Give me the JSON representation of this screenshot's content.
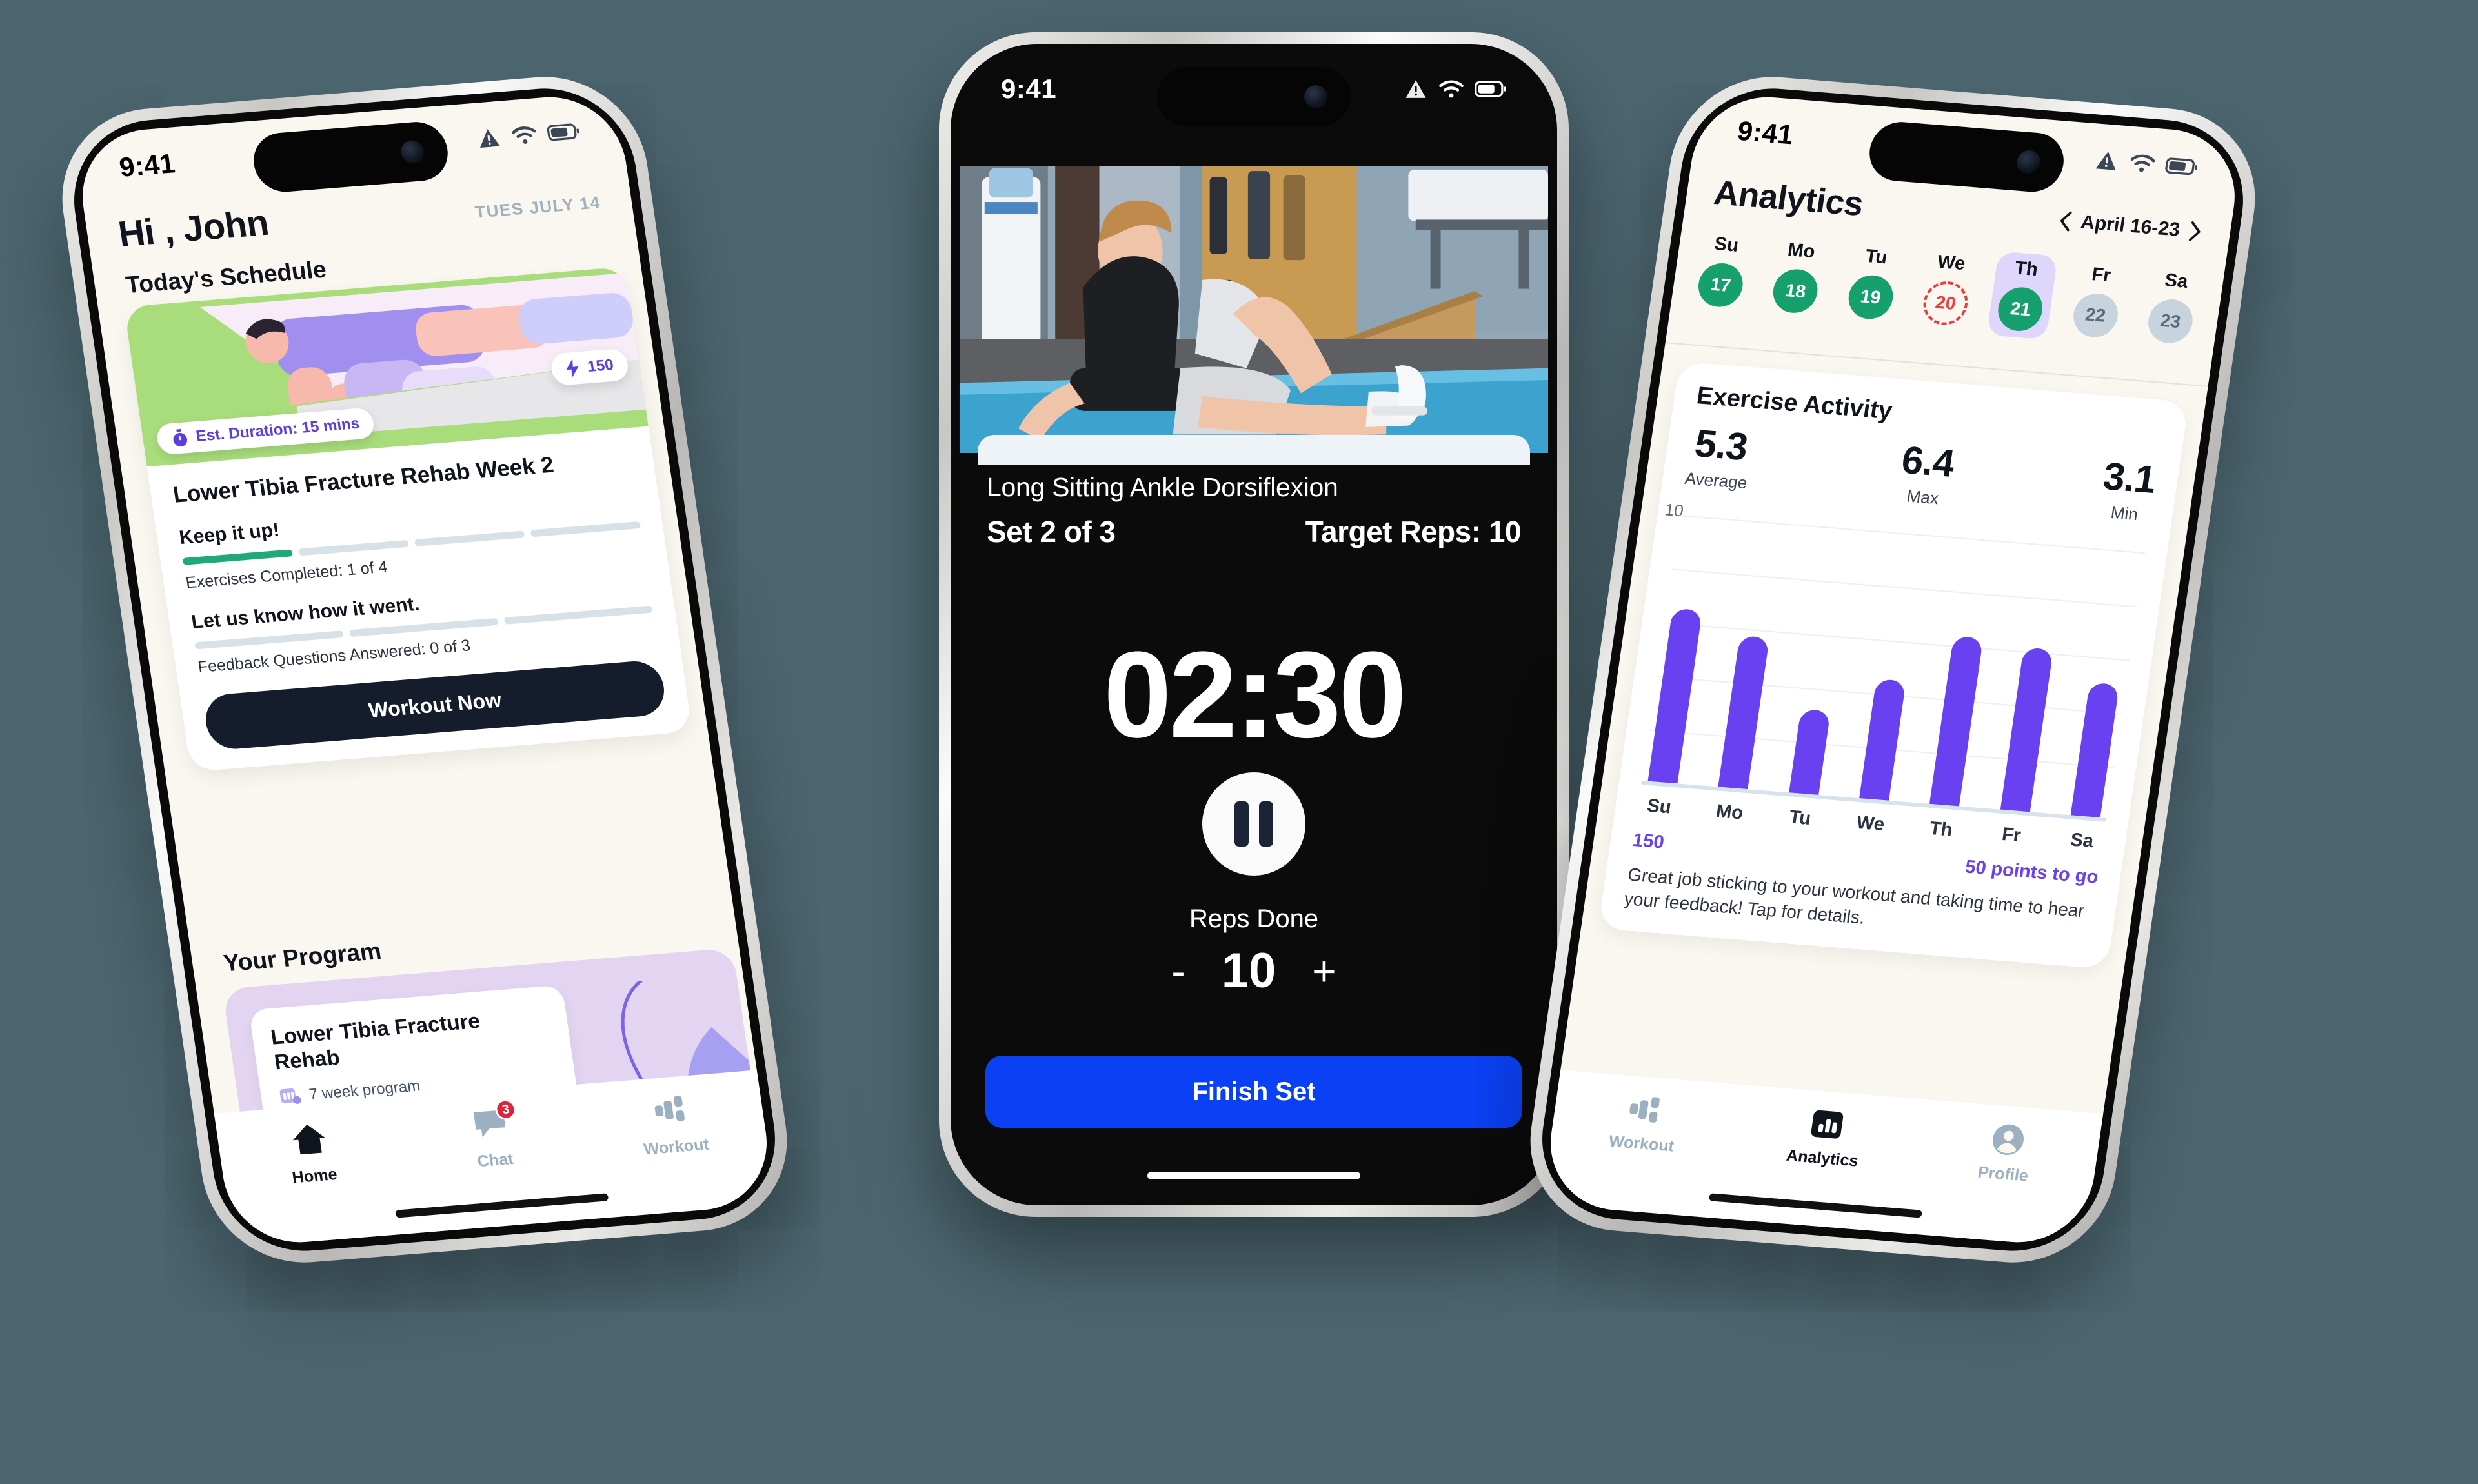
{
  "background_color": "#4c6670",
  "accent_colors": {
    "purple": "#6a41f0",
    "blue": "#0b41f5",
    "green": "#15a06e",
    "red": "#ef3b3b",
    "dark": "#151c2c"
  },
  "left_phone": {
    "status_bar": {
      "time": "9:41",
      "icons": [
        "alert-icon",
        "wifi-icon",
        "battery-icon"
      ]
    },
    "greeting": "Hi , John",
    "date": "TUES JULY 14",
    "section_today": "Today's Schedule",
    "hero": {
      "duration_badge": "Est. Duration: 15 mins",
      "duration_icon": "stopwatch-icon",
      "points_badge": "150",
      "points_icon": "bolt-icon"
    },
    "workout_title": "Lower Tibia Fracture Rehab Week 2",
    "keep_it_up": "Keep it up!",
    "exercises_progress": {
      "label": "Exercises Completed: 1 of 4",
      "segments": 4,
      "completed": 1
    },
    "feedback_heading": "Let us know how it went.",
    "feedback_progress": {
      "label": "Feedback Questions Answered: 0 of 3",
      "segments": 3,
      "completed": 0
    },
    "primary_button": "Workout Now",
    "section_program": "Your Program",
    "program_card": {
      "title": "Lower Tibia Fracture Rehab",
      "meta": "7 week program",
      "meta_icon": "calendar-icon"
    },
    "tabs": [
      {
        "label": "Home",
        "icon": "home-icon",
        "active": true,
        "badge": ""
      },
      {
        "label": "Chat",
        "icon": "chat-icon",
        "active": false,
        "badge": "3"
      },
      {
        "label": "Workout",
        "icon": "workout-icon",
        "active": false,
        "badge": ""
      }
    ]
  },
  "center_phone": {
    "status_bar": {
      "time": "9:41",
      "icons": [
        "alert-icon",
        "wifi-icon",
        "battery-icon"
      ]
    },
    "video": {
      "alt": "physical therapist seated on blue mat demonstrating long sitting ankle dorsiflexion"
    },
    "exercise_name": "Long Sitting Ankle Dorsiflexion",
    "set_label": "Set 2 of 3",
    "target_reps_label": "Target Reps: 10",
    "timer": "02:30",
    "pause_icon": "pause-icon",
    "reps_done_label": "Reps Done",
    "reps_minus": "-",
    "reps_value": "10",
    "reps_plus": "+",
    "finish_button": "Finish Set"
  },
  "right_phone": {
    "status_bar": {
      "time": "9:41",
      "icons": [
        "alert-icon",
        "wifi-icon",
        "battery-icon"
      ]
    },
    "title": "Analytics",
    "date_range": "April 16-23",
    "prev_icon": "chevron-left-icon",
    "next_icon": "chevron-right-icon",
    "calendar": [
      {
        "dow": "Su",
        "day": "17",
        "state": "done"
      },
      {
        "dow": "Mo",
        "day": "18",
        "state": "done"
      },
      {
        "dow": "Tu",
        "day": "19",
        "state": "done"
      },
      {
        "dow": "We",
        "day": "20",
        "state": "today"
      },
      {
        "dow": "Th",
        "day": "21",
        "state": "done",
        "selected": true
      },
      {
        "dow": "Fr",
        "day": "22",
        "state": "future"
      },
      {
        "dow": "Sa",
        "day": "23",
        "state": "future"
      }
    ],
    "card_title": "Exercise Activity",
    "stats": [
      {
        "value": "5.3",
        "label": "Average"
      },
      {
        "value": "6.4",
        "label": "Max"
      },
      {
        "value": "3.1",
        "label": "Min"
      }
    ],
    "points_left": "150",
    "points_to_go": "50 points to go",
    "note": "Great job sticking to your workout and taking time to hear your feedback! Tap for details.",
    "tabs": [
      {
        "label": "Workout",
        "icon": "workout-icon",
        "active": false
      },
      {
        "label": "Analytics",
        "icon": "analytics-icon",
        "active": true
      },
      {
        "label": "Profile",
        "icon": "profile-icon",
        "active": false
      }
    ]
  },
  "chart_data": {
    "type": "bar",
    "title": "Exercise Activity",
    "categories": [
      "Su",
      "Mo",
      "Tu",
      "We",
      "Th",
      "Fr",
      "Sa"
    ],
    "values": [
      6.4,
      5.6,
      3.1,
      4.4,
      6.2,
      6.0,
      4.9
    ],
    "xlabel": "",
    "ylabel": "",
    "ylim": [
      0,
      10
    ],
    "ytick_labels": [
      "10"
    ],
    "grid": true,
    "legend": "none",
    "bar_color": "#6a41f0",
    "summary": {
      "average": 5.3,
      "max": 6.4,
      "min": 3.1
    }
  }
}
